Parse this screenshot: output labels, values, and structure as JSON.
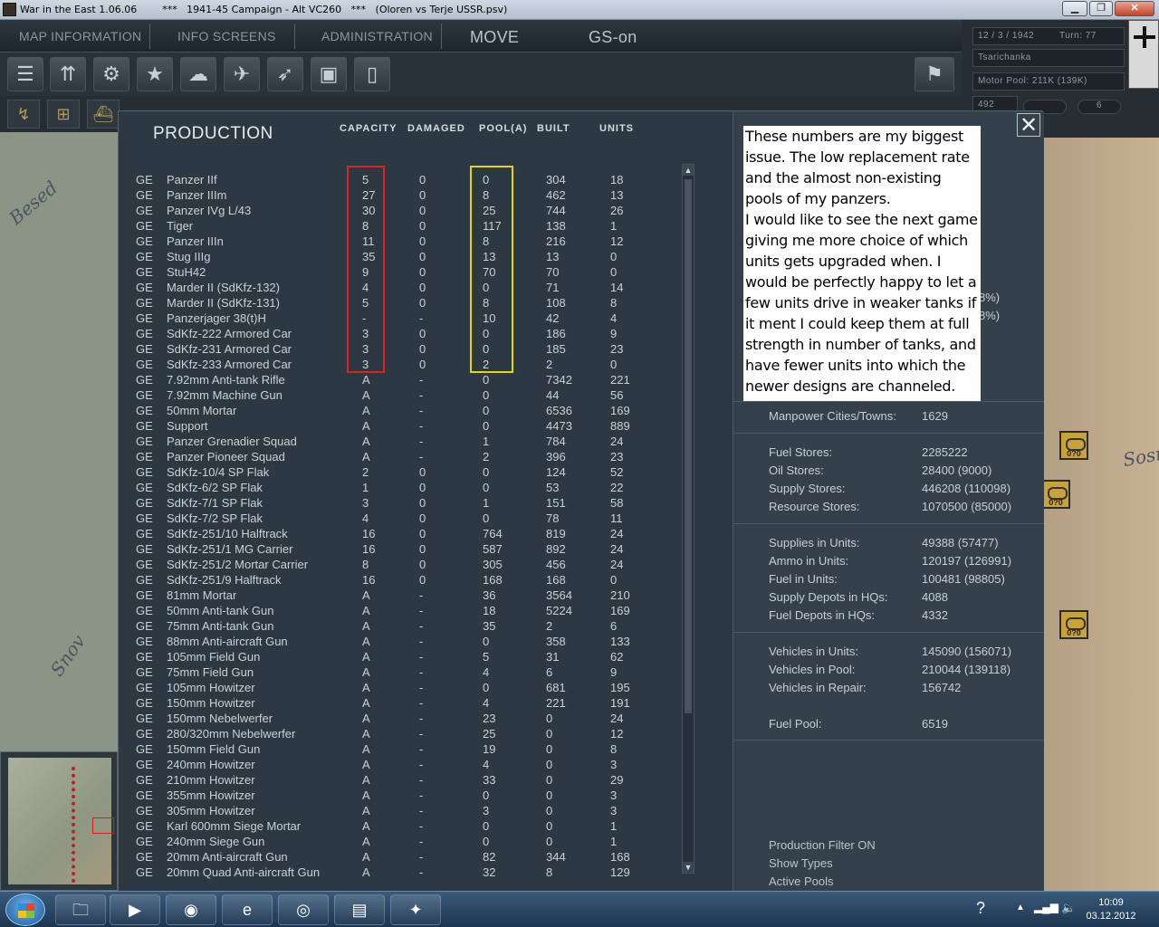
{
  "window": {
    "title": "War in the East 1.06.06        ***   1941-45 Campaign - Alt VC260   ***   (Oloren vs Terje USSR.psv)"
  },
  "menu": {
    "map_information": "MAP INFORMATION",
    "info_screens": "INFO SCREENS",
    "administration": "ADMINISTRATION",
    "move": "MOVE",
    "gs_on": "GS-on"
  },
  "status": {
    "date": "12 / 3 / 1942",
    "turn": "Turn: 77",
    "location": "Tsarichanka",
    "motor_pool": "Motor Pool:  211K (139K)",
    "small_value": "492",
    "step_value": "6"
  },
  "map": {
    "labels": [
      "Besed",
      "Snov",
      "Sosn"
    ],
    "counter_label": "0?0"
  },
  "production": {
    "title": "PRODUCTION",
    "columns": {
      "capacity": "CAPACITY",
      "damaged": "DAMAGED",
      "pool": "POOL(A)",
      "built": "BUILT",
      "units": "UNITS"
    },
    "rows": [
      {
        "nat": "GE",
        "name": "Panzer IIf",
        "cap": "5",
        "dam": "0",
        "pool": "0",
        "built": "304",
        "units": "18"
      },
      {
        "nat": "GE",
        "name": "Panzer IIIm",
        "cap": "27",
        "dam": "0",
        "pool": "8",
        "built": "462",
        "units": "13"
      },
      {
        "nat": "GE",
        "name": "Panzer IVg L/43",
        "cap": "30",
        "dam": "0",
        "pool": "25",
        "built": "744",
        "units": "26"
      },
      {
        "nat": "GE",
        "name": "Tiger",
        "cap": "8",
        "dam": "0",
        "pool": "117",
        "built": "138",
        "units": "1"
      },
      {
        "nat": "GE",
        "name": "Panzer IIIn",
        "cap": "11",
        "dam": "0",
        "pool": "8",
        "built": "216",
        "units": "12"
      },
      {
        "nat": "GE",
        "name": "Stug IIIg",
        "cap": "35",
        "dam": "0",
        "pool": "13",
        "built": "13",
        "units": "0"
      },
      {
        "nat": "GE",
        "name": "StuH42",
        "cap": "9",
        "dam": "0",
        "pool": "70",
        "built": "70",
        "units": "0"
      },
      {
        "nat": "GE",
        "name": "Marder II (SdKfz-132)",
        "cap": "4",
        "dam": "0",
        "pool": "0",
        "built": "71",
        "units": "14"
      },
      {
        "nat": "GE",
        "name": "Marder II (SdKfz-131)",
        "cap": "5",
        "dam": "0",
        "pool": "8",
        "built": "108",
        "units": "8"
      },
      {
        "nat": "GE",
        "name": "Panzerjager 38(t)H",
        "cap": "-",
        "dam": "-",
        "pool": "10",
        "built": "42",
        "units": "4"
      },
      {
        "nat": "GE",
        "name": "SdKfz-222 Armored Car",
        "cap": "3",
        "dam": "0",
        "pool": "0",
        "built": "186",
        "units": "9"
      },
      {
        "nat": "GE",
        "name": "SdKfz-231 Armored Car",
        "cap": "3",
        "dam": "0",
        "pool": "0",
        "built": "185",
        "units": "23"
      },
      {
        "nat": "GE",
        "name": "SdKfz-233 Armored Car",
        "cap": "3",
        "dam": "0",
        "pool": "2",
        "built": "2",
        "units": "0"
      },
      {
        "nat": "GE",
        "name": "7.92mm Anti-tank Rifle",
        "cap": "A",
        "dam": "-",
        "pool": "0",
        "built": "7342",
        "units": "221"
      },
      {
        "nat": "GE",
        "name": "7.92mm Machine Gun",
        "cap": "A",
        "dam": "-",
        "pool": "0",
        "built": "44",
        "units": "56"
      },
      {
        "nat": "GE",
        "name": "50mm Mortar",
        "cap": "A",
        "dam": "-",
        "pool": "0",
        "built": "6536",
        "units": "169"
      },
      {
        "nat": "GE",
        "name": "Support",
        "cap": "A",
        "dam": "-",
        "pool": "0",
        "built": "4473",
        "units": "889"
      },
      {
        "nat": "GE",
        "name": "Panzer Grenadier Squad",
        "cap": "A",
        "dam": "-",
        "pool": "1",
        "built": "784",
        "units": "24"
      },
      {
        "nat": "GE",
        "name": "Panzer Pioneer Squad",
        "cap": "A",
        "dam": "-",
        "pool": "2",
        "built": "396",
        "units": "23"
      },
      {
        "nat": "GE",
        "name": "SdKfz-10/4 SP Flak",
        "cap": "2",
        "dam": "0",
        "pool": "0",
        "built": "124",
        "units": "52"
      },
      {
        "nat": "GE",
        "name": "SdKfz-6/2 SP Flak",
        "cap": "1",
        "dam": "0",
        "pool": "0",
        "built": "53",
        "units": "22"
      },
      {
        "nat": "GE",
        "name": "SdKfz-7/1 SP Flak",
        "cap": "3",
        "dam": "0",
        "pool": "1",
        "built": "151",
        "units": "58"
      },
      {
        "nat": "GE",
        "name": "SdKfz-7/2 SP Flak",
        "cap": "4",
        "dam": "0",
        "pool": "0",
        "built": "78",
        "units": "11"
      },
      {
        "nat": "GE",
        "name": "SdKfz-251/10 Halftrack",
        "cap": "16",
        "dam": "0",
        "pool": "764",
        "built": "819",
        "units": "24"
      },
      {
        "nat": "GE",
        "name": "SdKfz-251/1 MG Carrier",
        "cap": "16",
        "dam": "0",
        "pool": "587",
        "built": "892",
        "units": "24"
      },
      {
        "nat": "GE",
        "name": "SdKfz-251/2 Mortar Carrier",
        "cap": "8",
        "dam": "0",
        "pool": "305",
        "built": "456",
        "units": "24"
      },
      {
        "nat": "GE",
        "name": "SdKfz-251/9 Halftrack",
        "cap": "16",
        "dam": "0",
        "pool": "168",
        "built": "168",
        "units": "0"
      },
      {
        "nat": "GE",
        "name": "81mm Mortar",
        "cap": "A",
        "dam": "-",
        "pool": "36",
        "built": "3564",
        "units": "210"
      },
      {
        "nat": "GE",
        "name": "50mm Anti-tank Gun",
        "cap": "A",
        "dam": "-",
        "pool": "18",
        "built": "5224",
        "units": "169"
      },
      {
        "nat": "GE",
        "name": "75mm Anti-tank Gun",
        "cap": "A",
        "dam": "-",
        "pool": "35",
        "built": "2",
        "units": "6"
      },
      {
        "nat": "GE",
        "name": "88mm Anti-aircraft Gun",
        "cap": "A",
        "dam": "-",
        "pool": "0",
        "built": "358",
        "units": "133"
      },
      {
        "nat": "GE",
        "name": "105mm Field Gun",
        "cap": "A",
        "dam": "-",
        "pool": "5",
        "built": "31",
        "units": "62"
      },
      {
        "nat": "GE",
        "name": "75mm Field Gun",
        "cap": "A",
        "dam": "-",
        "pool": "4",
        "built": "6",
        "units": "9"
      },
      {
        "nat": "GE",
        "name": "105mm Howitzer",
        "cap": "A",
        "dam": "-",
        "pool": "0",
        "built": "681",
        "units": "195"
      },
      {
        "nat": "GE",
        "name": "150mm Howitzer",
        "cap": "A",
        "dam": "-",
        "pool": "4",
        "built": "221",
        "units": "191"
      },
      {
        "nat": "GE",
        "name": "150mm Nebelwerfer",
        "cap": "A",
        "dam": "-",
        "pool": "23",
        "built": "0",
        "units": "24"
      },
      {
        "nat": "GE",
        "name": "280/320mm Nebelwerfer",
        "cap": "A",
        "dam": "-",
        "pool": "25",
        "built": "0",
        "units": "12"
      },
      {
        "nat": "GE",
        "name": "150mm Field Gun",
        "cap": "A",
        "dam": "-",
        "pool": "19",
        "built": "0",
        "units": "8"
      },
      {
        "nat": "GE",
        "name": "240mm Howitzer",
        "cap": "A",
        "dam": "-",
        "pool": "4",
        "built": "0",
        "units": "3"
      },
      {
        "nat": "GE",
        "name": "210mm Howitzer",
        "cap": "A",
        "dam": "-",
        "pool": "33",
        "built": "0",
        "units": "29"
      },
      {
        "nat": "GE",
        "name": "355mm Howitzer",
        "cap": "A",
        "dam": "-",
        "pool": "0",
        "built": "0",
        "units": "3"
      },
      {
        "nat": "GE",
        "name": "305mm Howitzer",
        "cap": "A",
        "dam": "-",
        "pool": "3",
        "built": "0",
        "units": "3"
      },
      {
        "nat": "GE",
        "name": "Karl 600mm Siege Mortar",
        "cap": "A",
        "dam": "-",
        "pool": "0",
        "built": "0",
        "units": "1"
      },
      {
        "nat": "GE",
        "name": "240mm Siege Gun",
        "cap": "A",
        "dam": "-",
        "pool": "0",
        "built": "0",
        "units": "1"
      },
      {
        "nat": "GE",
        "name": "20mm Anti-aircraft Gun",
        "cap": "A",
        "dam": "-",
        "pool": "82",
        "built": "344",
        "units": "168"
      },
      {
        "nat": "GE",
        "name": "20mm Quad Anti-aircraft Gun",
        "cap": "A",
        "dam": "-",
        "pool": "32",
        "built": "8",
        "units": "129"
      }
    ]
  },
  "note": {
    "paragraphs": [
      "These numbers are my biggest issue. The low replacement rate and the almost non-existing pools of my panzers.",
      "I would like to see the next game giving me more choice of which units gets upgraded when. I would be perfectly happy to let a few units drive in weaker tanks if it ment I could keep them at full strength in number of tanks, and have fewer units into which the newer designs are channeled."
    ]
  },
  "stats": {
    "partial": [
      "8%)",
      "8%)"
    ],
    "manpower": [
      {
        "label": "Manpower Cities/Towns:",
        "value": "1629"
      }
    ],
    "stores": [
      {
        "label": "Fuel Stores:",
        "value": "2285222"
      },
      {
        "label": "Oil Stores:",
        "value": "28400 (9000)"
      },
      {
        "label": "Supply Stores:",
        "value": "446208 (110098)"
      },
      {
        "label": "Resource Stores:",
        "value": "1070500 (85000)"
      }
    ],
    "units": [
      {
        "label": "Supplies in Units:",
        "value": "49388 (57477)"
      },
      {
        "label": "Ammo in Units:",
        "value": "120197 (126991)"
      },
      {
        "label": "Fuel in Units:",
        "value": "100481 (98805)"
      },
      {
        "label": "Supply Depots in HQs:",
        "value": "4088"
      },
      {
        "label": "Fuel Depots in HQs:",
        "value": "4332"
      }
    ],
    "vehicles": [
      {
        "label": "Vehicles in Units:",
        "value": "145090 (156071)"
      },
      {
        "label": "Vehicles in Pool:",
        "value": "210044 (139118)"
      },
      {
        "label": "Vehicles in Repair:",
        "value": "156742"
      }
    ],
    "fuel_pool": {
      "label": "Fuel Pool:",
      "value": "6519"
    }
  },
  "links": {
    "filter": "Production Filter ON",
    "show_types": "Show Types",
    "active_pools": "Active Pools"
  },
  "taskbar": {
    "time": "10:09",
    "date": "03.12.2012"
  },
  "colors": {
    "highlight_capacity": "#e02121",
    "highlight_pool": "#e5d21d"
  }
}
